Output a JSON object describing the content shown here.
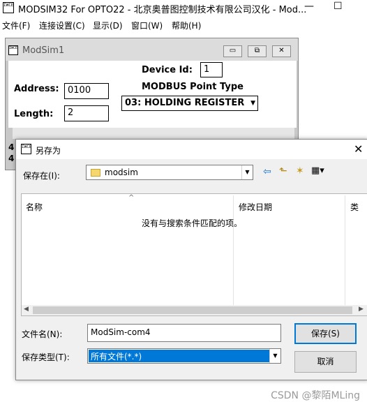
{
  "main_window": {
    "icon_text": "IWCE",
    "title": "MODSIM32 For OPTO22 - 北京奥普图控制技术有限公司汉化 - Mod...",
    "minimize_glyph": "—",
    "maximize_glyph": "☐"
  },
  "menu": {
    "file": "文件(F)",
    "connection": "连接设置(C)",
    "display": "显示(D)",
    "window": "窗口(W)",
    "help": "帮助(H)"
  },
  "child_window": {
    "title": "ModSim1",
    "minimize_glyph": "▭",
    "restore_glyph": "⧉",
    "close_glyph": "✕",
    "device_id_label": "Device Id:",
    "device_id_value": "1",
    "address_label": "Address:",
    "address_value": "0100",
    "length_label": "Length:",
    "length_value": "2",
    "point_type_label": "MODBUS Point Type",
    "point_type_value": "03: HOLDING REGISTER",
    "row_marker_1": "4",
    "row_marker_2": "4"
  },
  "dialog": {
    "title": "另存为",
    "close_glyph": "✕",
    "save_in_label": "保存在(I):",
    "save_in_value": "modsim",
    "toolbar_icons": {
      "back": "⇦",
      "up": "⬑",
      "new_folder": "✶",
      "views": "▦▾"
    },
    "columns": {
      "name": "名称",
      "modified": "修改日期",
      "type": "类"
    },
    "sort_glyph": "^",
    "empty_message": "没有与搜索条件匹配的项。",
    "file_name_label": "文件名(N):",
    "file_name_value": "ModSim-com4",
    "file_type_label": "保存类型(T):",
    "file_type_value": "所有文件(*.*)",
    "save_button": "保存(S)",
    "cancel_button": "取消",
    "accent_color": "#0078d7"
  },
  "watermark": "CSDN @黎陌MLing"
}
